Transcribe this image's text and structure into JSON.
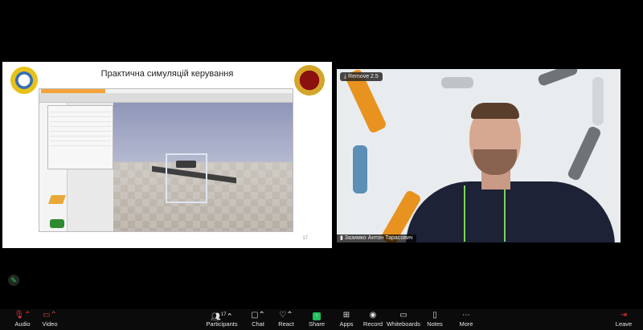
{
  "slide": {
    "title": "Практична симуляцій керування",
    "page_number": "17"
  },
  "video": {
    "recording_badge": "Remove 2.5",
    "participant_name": "Зазимко Антон Тарасович"
  },
  "toolbar": {
    "audio": "Audio",
    "video": "Video",
    "participants": "Participants",
    "participants_count": "17",
    "chat": "Chat",
    "react": "React",
    "share": "Share",
    "apps": "Apps",
    "record": "Record",
    "whiteboards": "Whiteboards",
    "notes": "Notes",
    "more": "More",
    "leave": "Leave"
  },
  "colors": {
    "share": "#1fbf5a",
    "leave": "#e03b3b",
    "annotate": "#3ec35b"
  }
}
